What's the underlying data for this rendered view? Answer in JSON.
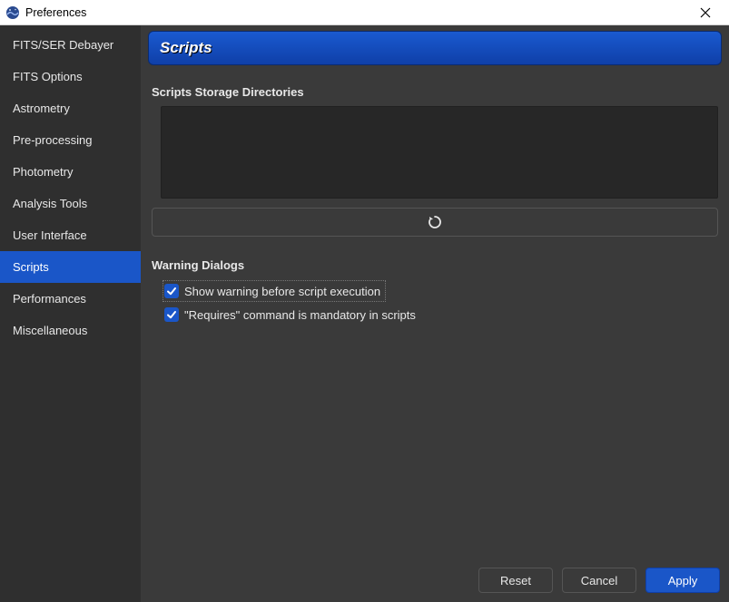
{
  "window": {
    "title": "Preferences"
  },
  "sidebar": {
    "items": [
      {
        "label": "FITS/SER Debayer"
      },
      {
        "label": "FITS Options"
      },
      {
        "label": "Astrometry"
      },
      {
        "label": "Pre-processing"
      },
      {
        "label": "Photometry"
      },
      {
        "label": "Analysis Tools"
      },
      {
        "label": "User Interface"
      },
      {
        "label": "Scripts",
        "active": true
      },
      {
        "label": "Performances"
      },
      {
        "label": "Miscellaneous"
      }
    ]
  },
  "page": {
    "title": "Scripts",
    "sections": {
      "storage_label": "Scripts Storage Directories",
      "warning_label": "Warning Dialogs"
    },
    "checks": {
      "warn_before_exec": {
        "label": "Show warning before script execution",
        "checked": true
      },
      "requires_mandatory": {
        "label": "\"Requires\" command is mandatory in scripts",
        "checked": true
      }
    }
  },
  "footer": {
    "reset": "Reset",
    "cancel": "Cancel",
    "apply": "Apply"
  },
  "colors": {
    "accent": "#1a56c8",
    "bg": "#3a3a3a",
    "panel": "#2f2f2f"
  }
}
